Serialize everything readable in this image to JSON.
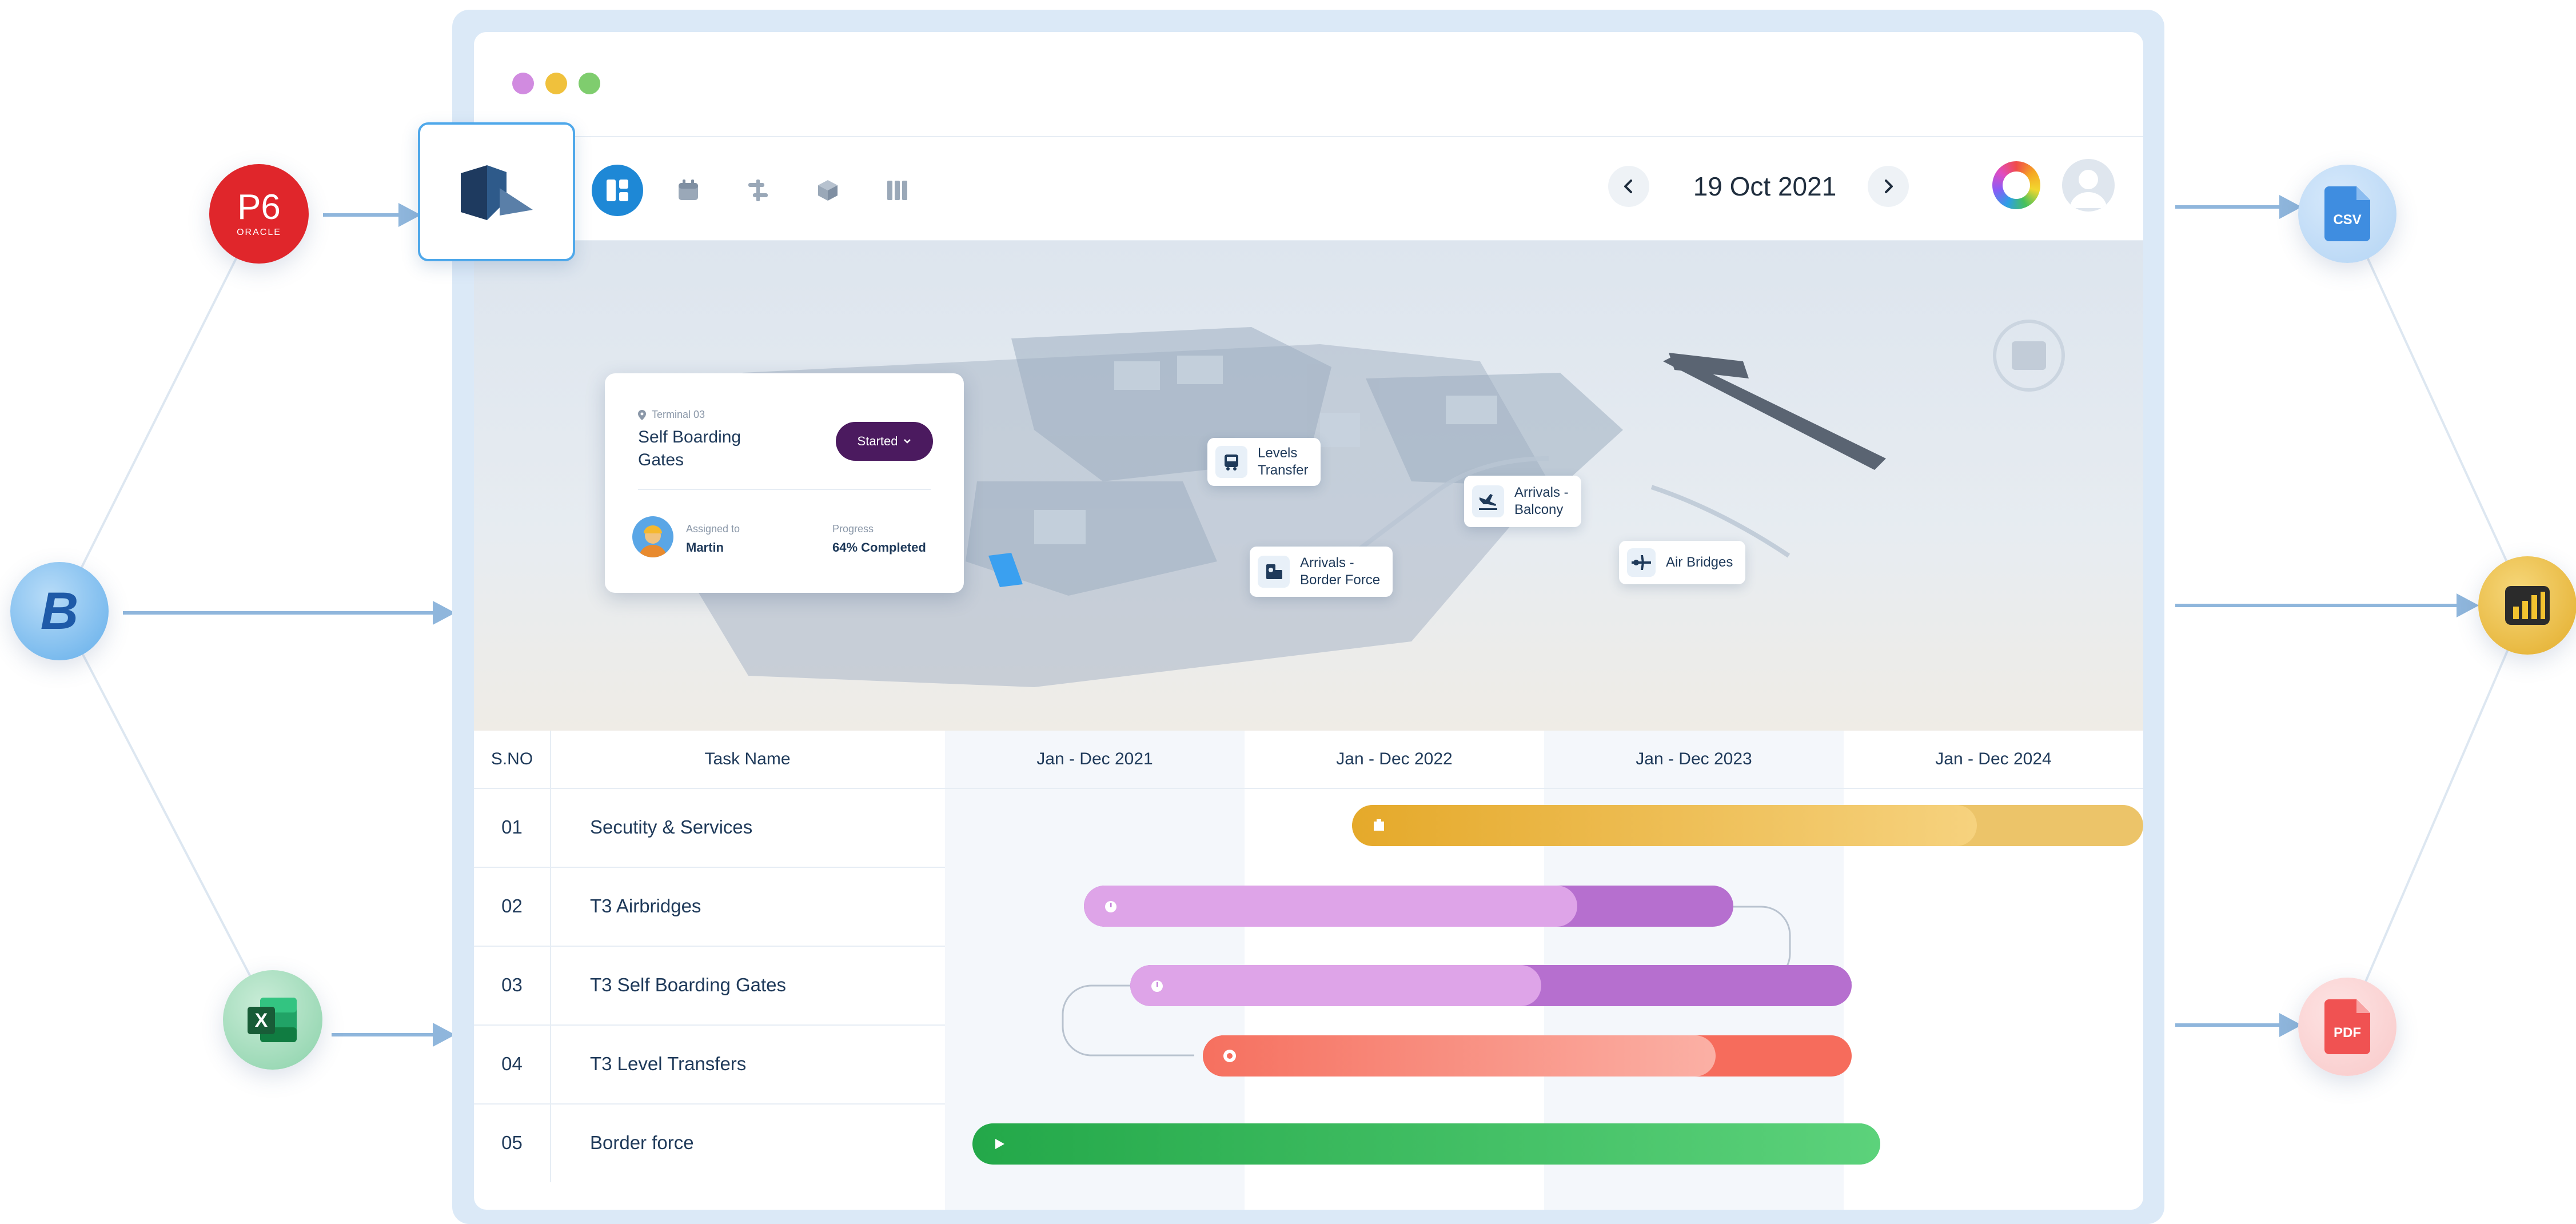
{
  "integrations": {
    "left": [
      {
        "name": "P6",
        "sub": "ORACLE",
        "color": "#e0262b"
      },
      {
        "name": "B",
        "color": "#5aa6e6"
      },
      {
        "name": "X",
        "color": "#2e9b5a"
      }
    ],
    "right": [
      {
        "name": "CSV",
        "color": "#4a8fe0"
      },
      {
        "name": "PDF",
        "color": "#f05252"
      }
    ]
  },
  "window": {
    "dots": [
      "#d18be0",
      "#f0c13c",
      "#7fcd6e"
    ]
  },
  "toolbar": {
    "date": "19 Oct 2021",
    "accent": "#1e88d6"
  },
  "map": {
    "labels": [
      {
        "text": "Levels\nTransfer",
        "icon": "bus-icon"
      },
      {
        "text": "Arrivals -\nBalcony",
        "icon": "airplane-landing-icon"
      },
      {
        "text": "Arrivals -\nBorder Force",
        "icon": "passport-icon"
      },
      {
        "text": "Air Bridges",
        "icon": "air-bridge-icon"
      }
    ],
    "card": {
      "location": "Terminal 03",
      "title_line1": "Self Boarding",
      "title_line2": "Gates",
      "status": "Started",
      "assigned_label": "Assigned to",
      "assignee": "Martin",
      "progress_label": "Progress",
      "progress": "64% Completed"
    }
  },
  "table": {
    "headers": {
      "sno": "S.NO",
      "task": "Task Name"
    },
    "years": [
      "Jan - Dec 2021",
      "Jan - Dec 2022",
      "Jan - Dec 2023",
      "Jan - Dec 2024"
    ],
    "rows": [
      {
        "sn": "01",
        "task": "Secutity & Services",
        "color": "#e9b43c",
        "progress": 0.79
      },
      {
        "sn": "02",
        "task": "T3 Airbridges",
        "color": "#c47fd9",
        "progress": 0.76
      },
      {
        "sn": "03",
        "task": "T3 Self Boarding Gates",
        "color": "#c47fd9",
        "progress": 0.57
      },
      {
        "sn": "04",
        "task": "T3 Level Transfers",
        "color": "#f66c5c",
        "progress": 0.79
      },
      {
        "sn": "05",
        "task": "Border force",
        "color": "#33b95c",
        "progress": 1.0
      }
    ]
  }
}
